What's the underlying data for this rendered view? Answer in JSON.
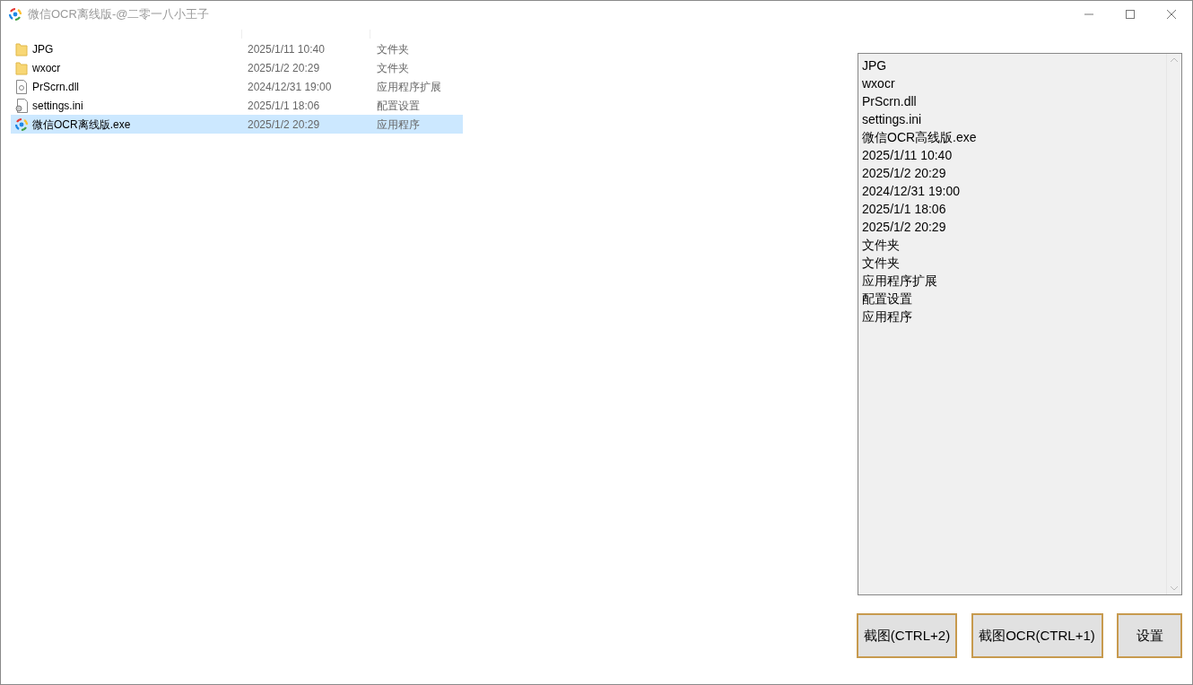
{
  "window": {
    "title": "微信OCR离线版-@二零一八小王子"
  },
  "files": [
    {
      "name": "JPG",
      "modified": "2025/1/11 10:40",
      "type": "文件夹",
      "kind": "folder",
      "selected": false
    },
    {
      "name": "wxocr",
      "modified": "2025/1/2 20:29",
      "type": "文件夹",
      "kind": "folder",
      "selected": false
    },
    {
      "name": "PrScrn.dll",
      "modified": "2024/12/31 19:00",
      "type": "应用程序扩展",
      "kind": "dll",
      "selected": false
    },
    {
      "name": "settings.ini",
      "modified": "2025/1/1 18:06",
      "type": "配置设置",
      "kind": "ini",
      "selected": false
    },
    {
      "name": "微信OCR离线版.exe",
      "modified": "2025/1/2 20:29",
      "type": "应用程序",
      "kind": "app",
      "selected": true
    }
  ],
  "text_area": {
    "lines": [
      "JPG",
      "wxocr",
      "PrScrn.dll",
      "settings.ini",
      "微信OCR高线版.exe",
      "2025/1/11 10:40",
      "2025/1/2 20:29",
      "2024/12/31 19:00",
      "2025/1/1 18:06",
      "2025/1/2 20:29",
      "文件夹",
      "文件夹",
      "应用程序扩展",
      "配置设置",
      "应用程序"
    ]
  },
  "buttons": [
    "截图(CTRL+2)",
    "截图OCR(CTRL+1)",
    "设置"
  ]
}
